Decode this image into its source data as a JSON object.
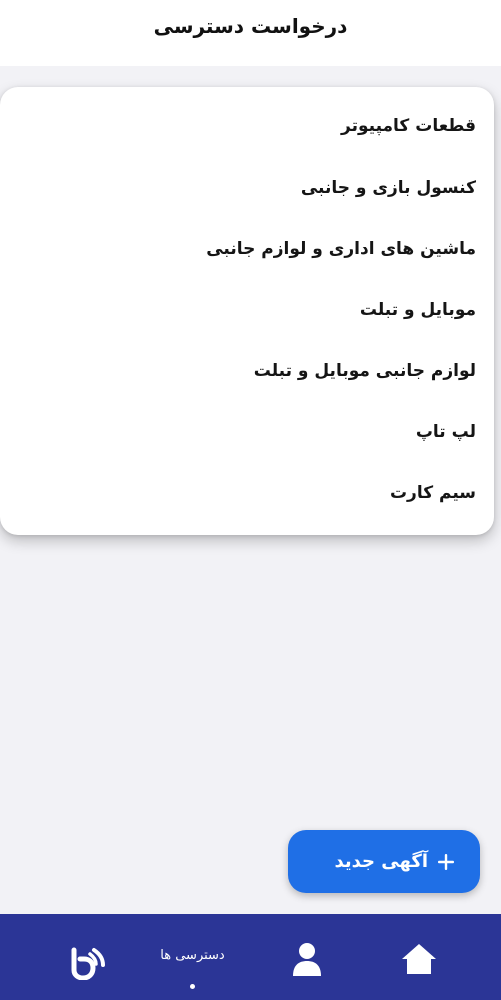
{
  "header": {
    "title": "درخواست دسترسی"
  },
  "dropdown": {
    "items": [
      "قطعات کامپیوتر",
      "کنسول بازی و جانبی",
      "ماشین های اداری و لوازم جانبی",
      "موبایل و تبلت",
      "لوازم جانبی موبایل و تبلت",
      "لپ تاپ",
      "سیم کارت"
    ]
  },
  "fab": {
    "label": "آگهی جدید",
    "icon": "plus-icon"
  },
  "bottom_nav": {
    "items": [
      {
        "icon": "home-icon",
        "label": ""
      },
      {
        "icon": "user-icon",
        "label": ""
      },
      {
        "icon": "",
        "label": "دسترسی ها",
        "active": true
      },
      {
        "icon": "brand-logo-icon",
        "label": ""
      }
    ]
  },
  "colors": {
    "accent": "#1f6fe6",
    "nav_background": "#2b3596",
    "header_background": "#ffffff",
    "page_background": "#f2f2f6"
  }
}
